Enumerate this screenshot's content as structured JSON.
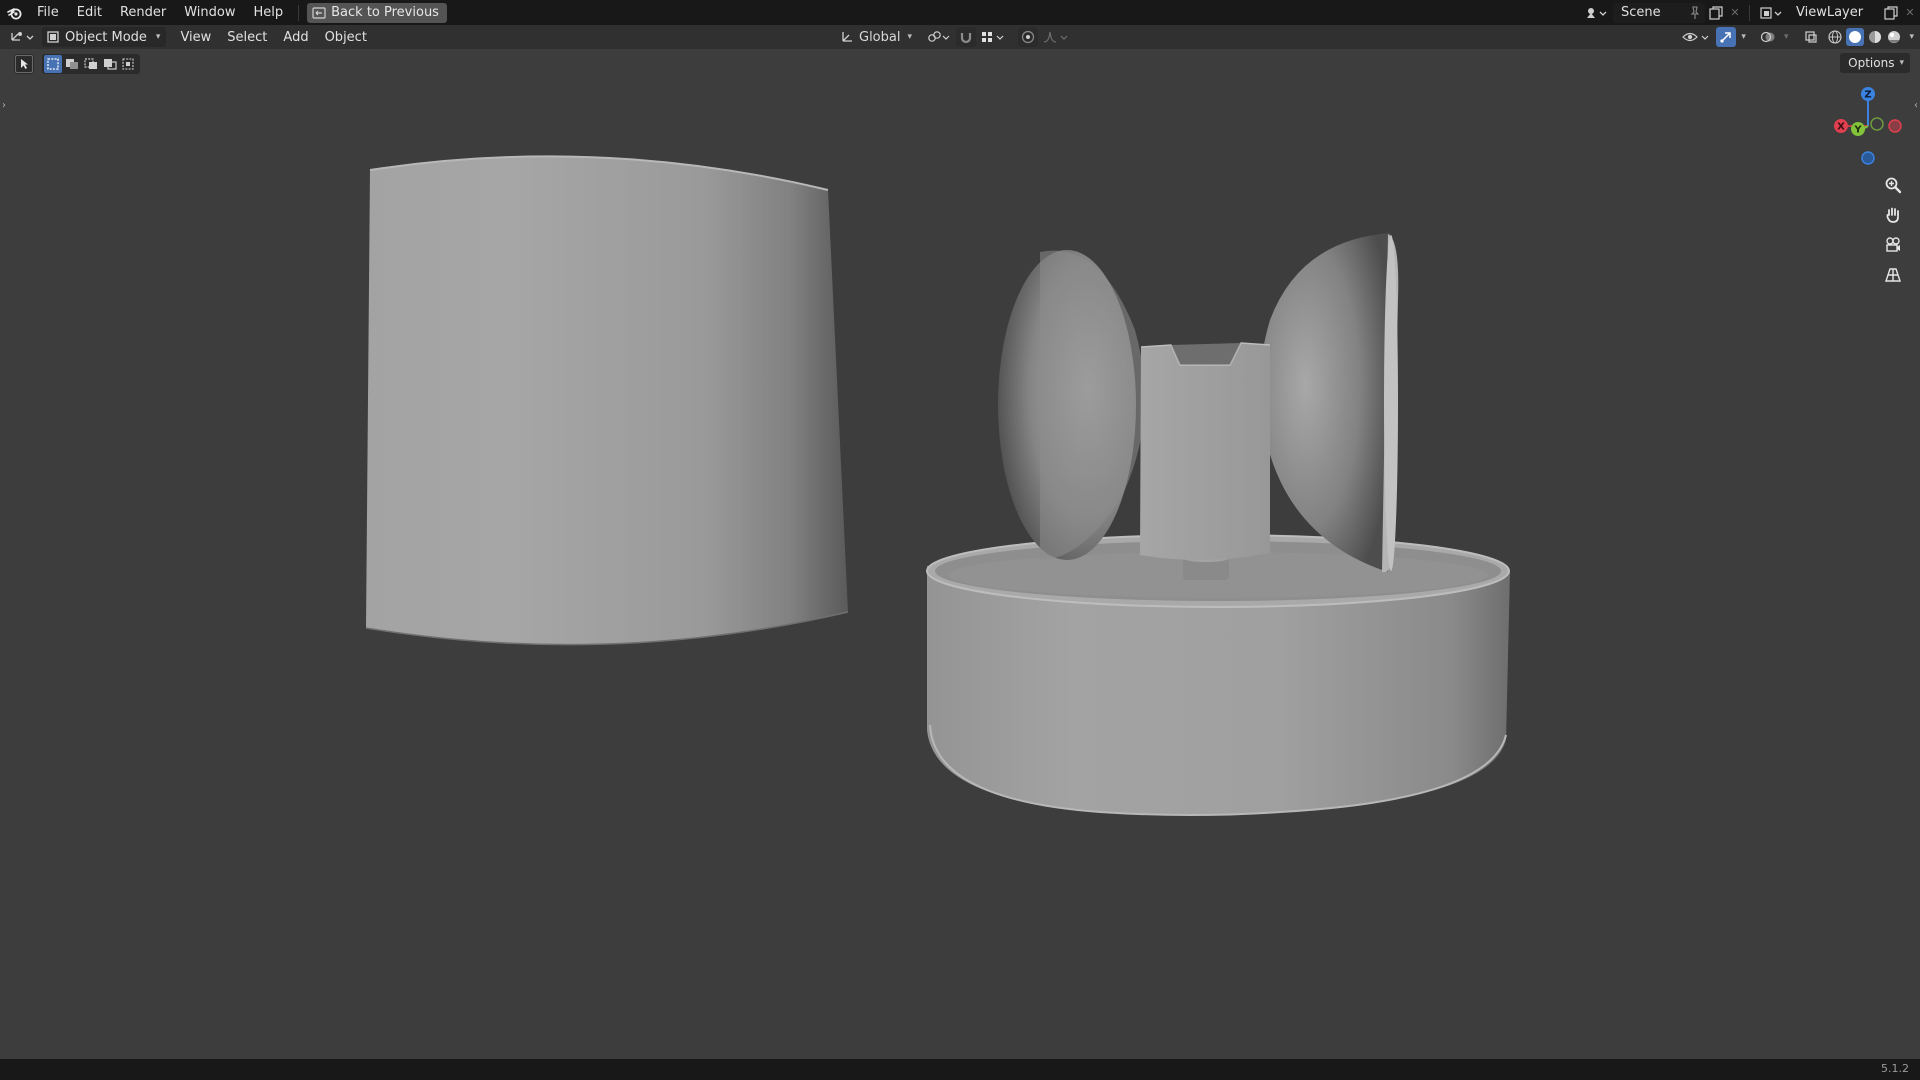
{
  "topbar": {
    "menus": [
      "File",
      "Edit",
      "Render",
      "Window",
      "Help"
    ],
    "back_button": "Back to Previous",
    "scene_name": "Scene",
    "view_layer": "ViewLayer"
  },
  "header": {
    "mode": "Object Mode",
    "menus": [
      "View",
      "Select",
      "Add",
      "Object"
    ],
    "transform_orientation": "Global"
  },
  "viewport": {
    "options_label": "Options"
  },
  "gizmo": {
    "axes": [
      "X",
      "Y",
      "Z"
    ],
    "colors": {
      "x": "#e0404f",
      "y": "#82c33b",
      "z": "#3b82e0"
    }
  },
  "status": {
    "version": "5.1.2"
  },
  "icons": {
    "logo": "blender-logo-icon",
    "nav": [
      "zoom-icon",
      "pan-hand-icon",
      "camera-icon",
      "perspective-grid-icon"
    ]
  }
}
